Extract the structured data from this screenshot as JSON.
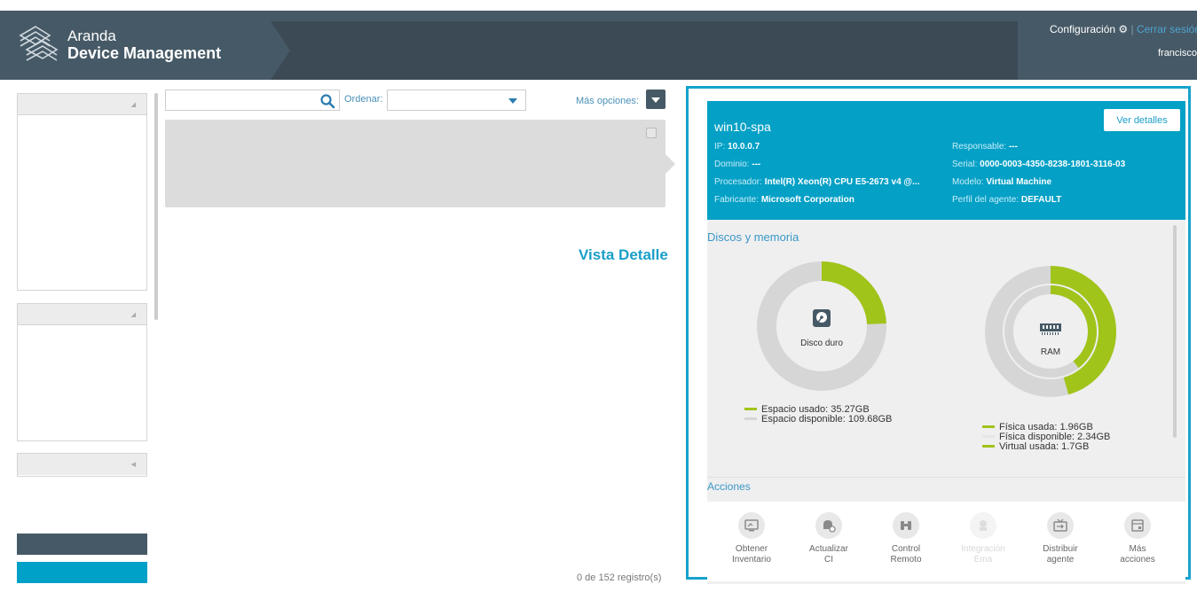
{
  "header": {
    "brand_line1": "Aranda",
    "brand_line2": "Device Management",
    "config_label": "Configuración",
    "separator": "|",
    "logout_label": "Cerrar sesión",
    "user_name": "francisco"
  },
  "toolbar": {
    "search_placeholder": "",
    "order_label": "Ordenar:",
    "order_value": "",
    "more_label": "Más opciones:"
  },
  "main": {
    "view_label": "Vista Detalle",
    "records_label": "0 de 152 registro(s)"
  },
  "detail": {
    "title": "win10-spa",
    "details_button": "Ver detalles",
    "left_fields": [
      {
        "key": "IP:",
        "value": "10.0.0.7"
      },
      {
        "key": "Dominio:",
        "value": "---"
      },
      {
        "key": "Procesador:",
        "value": "Intel(R) Xeon(R) CPU E5-2673 v4 @..."
      },
      {
        "key": "Fabricante:",
        "value": "Microsoft Corporation"
      }
    ],
    "right_fields": [
      {
        "key": "Responsable:",
        "value": "---"
      },
      {
        "key": "Serial:",
        "value": "0000-0003-4350-8238-1801-3116-03"
      },
      {
        "key": "Modelo:",
        "value": "Virtual Machine"
      },
      {
        "key": "Perfil del agente:",
        "value": "DEFAULT"
      }
    ],
    "disks_title": "Discos y memoria",
    "disk": {
      "label": "Disco duro",
      "used_label": "Espacio usado: 35.27GB",
      "free_label": "Espacio disponible: 109.68GB",
      "used_gb": 35.27,
      "free_gb": 109.68
    },
    "ram": {
      "label": "RAM",
      "physical_used_label": "Física usada: 1.96GB",
      "physical_free_label": "Física disponible: 2.34GB",
      "virtual_used_label": "Virtual usada: 1.7GB",
      "physical_used_gb": 1.96,
      "physical_free_gb": 2.34,
      "virtual_used_gb": 1.7
    },
    "actions_title": "Acciones",
    "actions": [
      {
        "line1": "Obtener",
        "line2": "Inventario",
        "icon": "inventory-icon",
        "enabled": true
      },
      {
        "line1": "Actualizar",
        "line2": "CI",
        "icon": "update-ci-icon",
        "enabled": true
      },
      {
        "line1": "Control",
        "line2": "Remoto",
        "icon": "binoculars-icon",
        "enabled": true
      },
      {
        "line1": "Integración",
        "line2": "Ema",
        "icon": "integration-icon",
        "enabled": false
      },
      {
        "line1": "Distribuir",
        "line2": "agente",
        "icon": "distribute-icon",
        "enabled": true
      },
      {
        "line1": "Más",
        "line2": "acciones",
        "icon": "more-actions-icon",
        "enabled": true
      }
    ]
  },
  "colors": {
    "header_bg": "#465966",
    "accent_cyan": "#04a0c6",
    "used_green": "#a0c41a",
    "free_gray": "#d6d6d6"
  }
}
